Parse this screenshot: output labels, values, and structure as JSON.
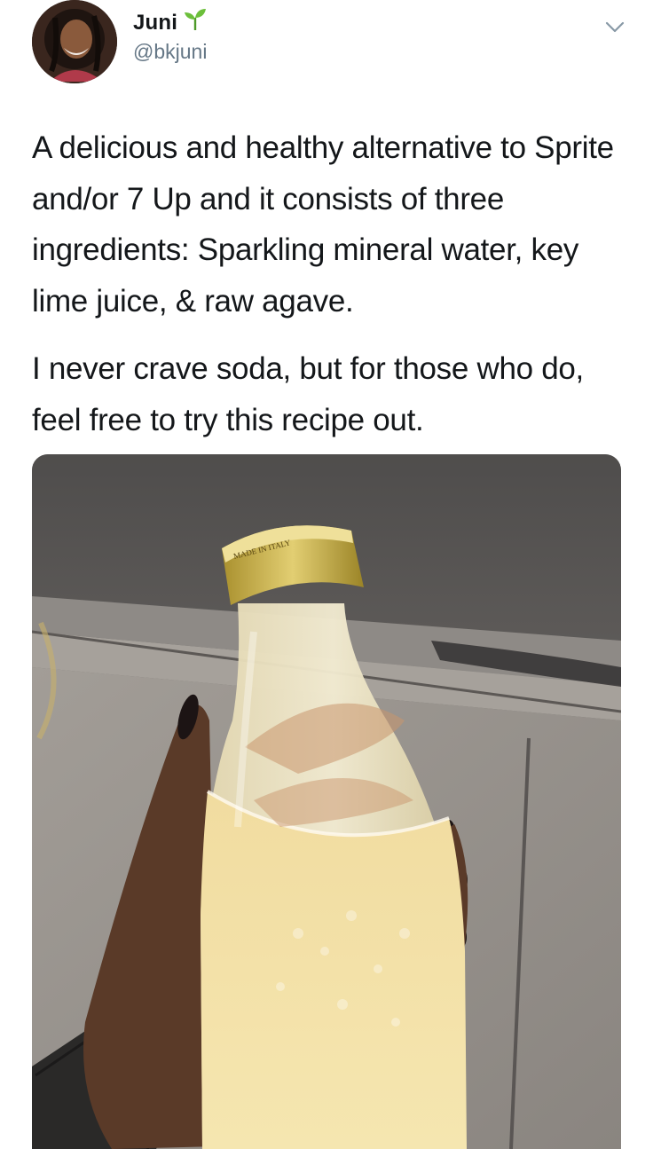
{
  "tweet": {
    "author": {
      "display_name": "Juni",
      "name_emoji": "seedling-icon",
      "handle": "@bkjuni"
    },
    "menu_icon": "chevron-down-icon",
    "paragraphs": [
      "A delicious and healthy alternative to Sprite and/or 7 Up and it consists of three ingredients: Sparkling mineral water, key lime juice, & raw agave.",
      "I never crave soda, but for those who do, feel free to try this recipe out."
    ],
    "media": {
      "bottle_cap_text": "MADE IN ITALY"
    }
  },
  "colors": {
    "text": "#14171a",
    "secondary": "#657786",
    "seedling": "#6cbf3b"
  }
}
